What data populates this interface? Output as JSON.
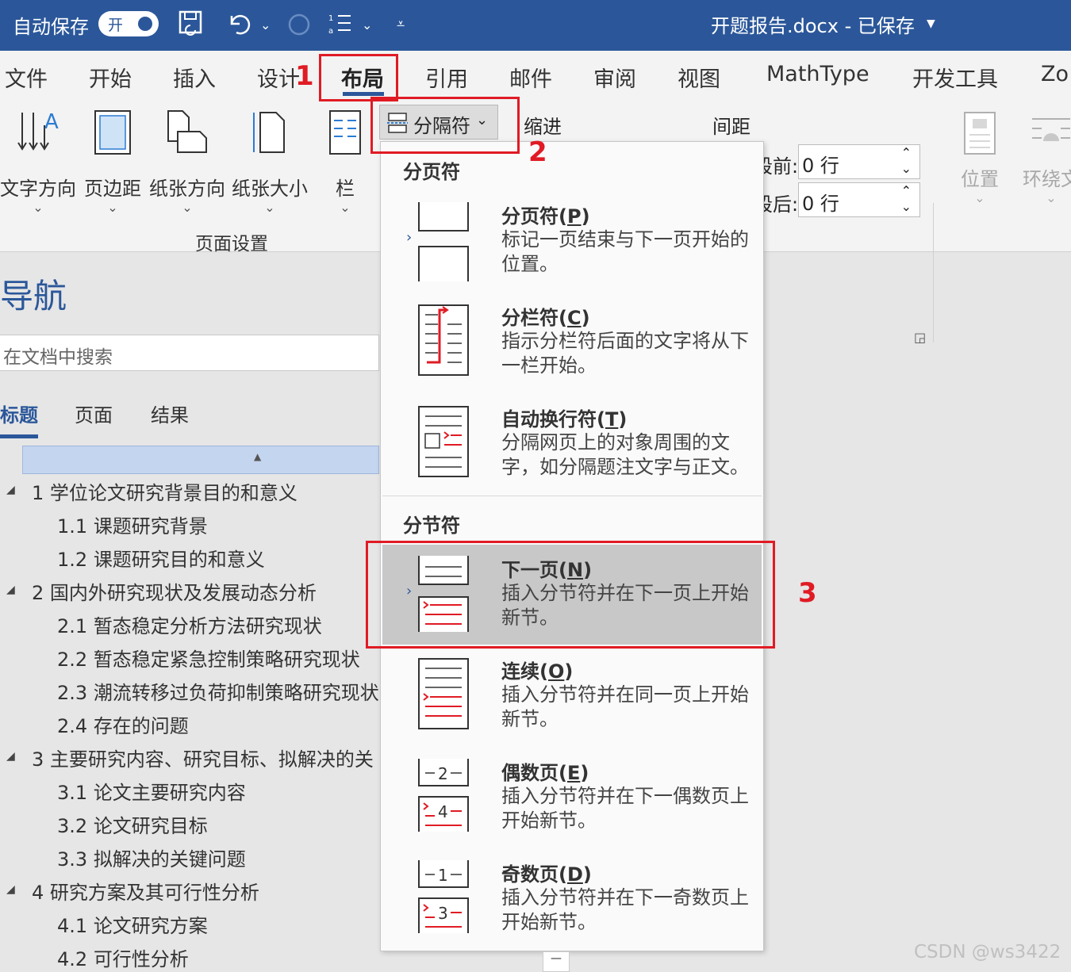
{
  "titlebar": {
    "autosave_label": "自动保存",
    "toggle_state": "开",
    "doc_title": "开题报告.docx - 已保存",
    "background": "#2b579a"
  },
  "tabs": [
    "文件",
    "开始",
    "插入",
    "设计",
    "布局",
    "引用",
    "邮件",
    "审阅",
    "视图",
    "MathType",
    "开发工具",
    "Zo"
  ],
  "active_tab": "布局",
  "ribbon": {
    "page_setup": {
      "buttons": [
        "文字方向",
        "页边距",
        "纸张方向",
        "纸张大小",
        "栏"
      ],
      "group_label": "页面设置"
    },
    "breaks_button": "分隔符",
    "indent_header": "缩进",
    "spacing_header": "间距",
    "spacing_before_label": "段前:",
    "spacing_before_value": "0 行",
    "spacing_after_label": "段后:",
    "spacing_after_value": "0 行",
    "arrange_buttons": [
      "位置",
      "环绕文"
    ]
  },
  "nav_pane": {
    "title": "导航",
    "search_placeholder": "在文档中搜索",
    "tabs": [
      "标题",
      "页面",
      "结果"
    ],
    "active_tab": "标题",
    "headings": [
      {
        "num": "1",
        "text": "学位论文研究背景目的和意义",
        "level": 1
      },
      {
        "num": "1.1",
        "text": "课题研究背景",
        "level": 2
      },
      {
        "num": "1.2",
        "text": "课题研究目的和意义",
        "level": 2
      },
      {
        "num": "2",
        "text": "国内外研究现状及发展动态分析",
        "level": 1
      },
      {
        "num": "2.1",
        "text": "暂态稳定分析方法研究现状",
        "level": 2
      },
      {
        "num": "2.2",
        "text": "暂态稳定紧急控制策略研究现状",
        "level": 2
      },
      {
        "num": "2.3",
        "text": "潮流转移过负荷抑制策略研究现状",
        "level": 2
      },
      {
        "num": "2.4",
        "text": "存在的问题",
        "level": 2
      },
      {
        "num": "3",
        "text": "主要研究内容、研究目标、拟解决的关",
        "level": 1
      },
      {
        "num": "3.1",
        "text": "论文主要研究内容",
        "level": 2
      },
      {
        "num": "3.2",
        "text": "论文研究目标",
        "level": 2
      },
      {
        "num": "3.3",
        "text": "拟解决的关键问题",
        "level": 2
      },
      {
        "num": "4",
        "text": "研究方案及其可行性分析",
        "level": 1
      },
      {
        "num": "4.1",
        "text": "论文研究方案",
        "level": 2
      },
      {
        "num": "4.2",
        "text": "可行性分析",
        "level": 2
      }
    ]
  },
  "breaks_menu": {
    "page_breaks_header": "分页符",
    "section_breaks_header": "分节符",
    "items": [
      {
        "title": "分页符(",
        "key": "P",
        "desc": "标记一页结束与下一页开始的位置。"
      },
      {
        "title": "分栏符(",
        "key": "C",
        "desc": "指示分栏符后面的文字将从下一栏开始。"
      },
      {
        "title": "自动换行符(",
        "key": "T",
        "desc": "分隔网页上的对象周围的文字，如分隔题注文字与正文。"
      },
      {
        "title": "下一页(",
        "key": "N",
        "desc": "插入分节符并在下一页上开始新节。"
      },
      {
        "title": "连续(",
        "key": "O",
        "desc": "插入分节符并在同一页上开始新节。"
      },
      {
        "title": "偶数页(",
        "key": "E",
        "desc": "插入分节符并在下一偶数页上开始新节。"
      },
      {
        "title": "奇数页(",
        "key": "D",
        "desc": "插入分节符并在下一奇数页上开始新节。"
      }
    ],
    "highlighted": "下一页"
  },
  "annotations": {
    "step1": "1",
    "step2": "2",
    "step3": "3",
    "color": "#e01b24"
  },
  "watermark": "CSDN @ws3422"
}
